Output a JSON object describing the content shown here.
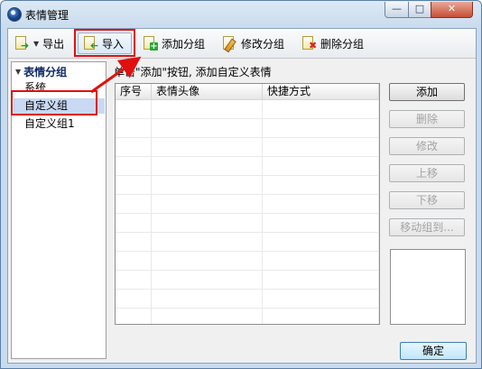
{
  "window": {
    "title": "表情管理",
    "min_glyph": "—",
    "max_glyph": "□",
    "close_glyph": "✕"
  },
  "toolbar": {
    "export_label": "导出",
    "import_label": "导入",
    "add_group_label": "添加分组",
    "edit_group_label": "修改分组",
    "delete_group_label": "删除分组"
  },
  "sidebar": {
    "header": "表情分组",
    "items": [
      {
        "label": "系统"
      },
      {
        "label": "自定义组"
      },
      {
        "label": "自定义组1"
      }
    ]
  },
  "main": {
    "hint": "单击\"添加\"按钮, 添加自定义表情",
    "columns": [
      "序号",
      "表情头像",
      "快捷方式"
    ],
    "buttons": {
      "add": "添加",
      "delete": "删除",
      "edit": "修改",
      "move_up": "上移",
      "move_down": "下移",
      "move_to_group": "移动组到..."
    }
  },
  "footer": {
    "ok_label": "确定"
  },
  "colors": {
    "highlight": "#e01010",
    "selected": "#c9d9f4",
    "tree_header": "#0d2a66"
  }
}
